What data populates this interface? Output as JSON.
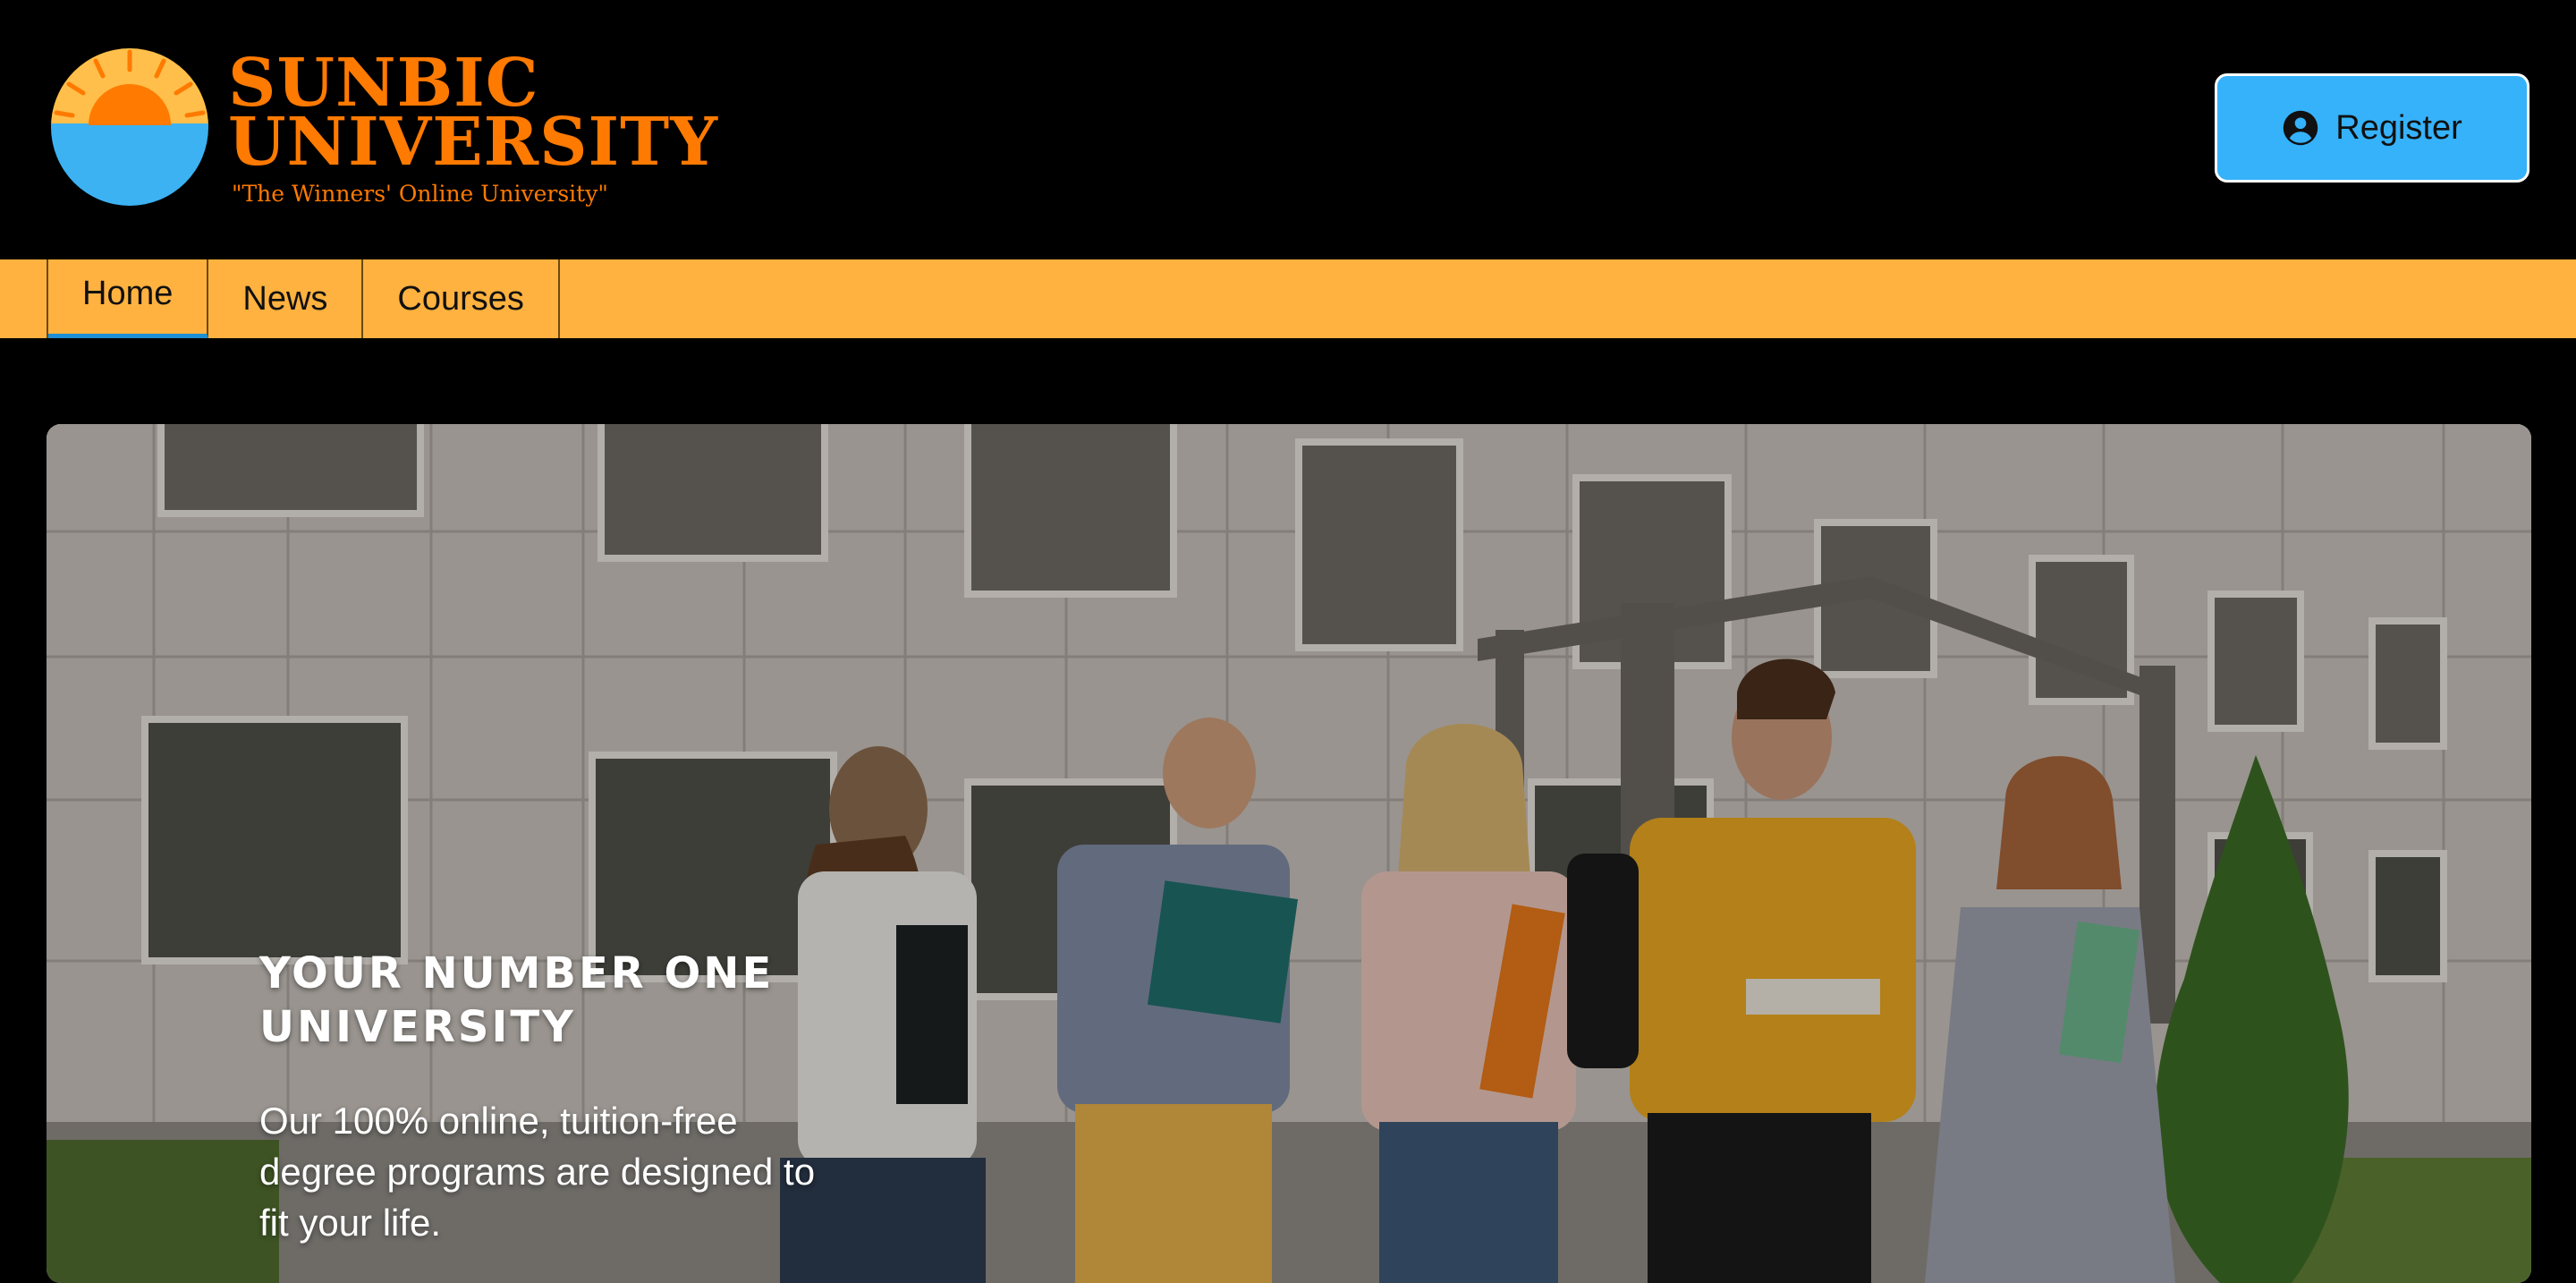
{
  "brand": {
    "name_line1": "SUNBIC",
    "name_line2": "UNIVERSITY",
    "tagline": "\"The Winners' Online University\"",
    "logo_icon": "sun-over-sea-logo",
    "color": "#ff7a00"
  },
  "header": {
    "register_label": "Register",
    "register_icon": "account-circle-icon",
    "register_color": "#35b2fa"
  },
  "nav": {
    "background": "#ffb23f",
    "items": [
      {
        "label": "Home",
        "active": true
      },
      {
        "label": "News",
        "active": false
      },
      {
        "label": "Courses",
        "active": false
      }
    ]
  },
  "hero": {
    "image": "students-walking-on-campus-photo",
    "heading": "YOUR NUMBER ONE UNIVERSITY",
    "text": "Our 100% online, tuition-free degree programs are designed to fit your life."
  }
}
